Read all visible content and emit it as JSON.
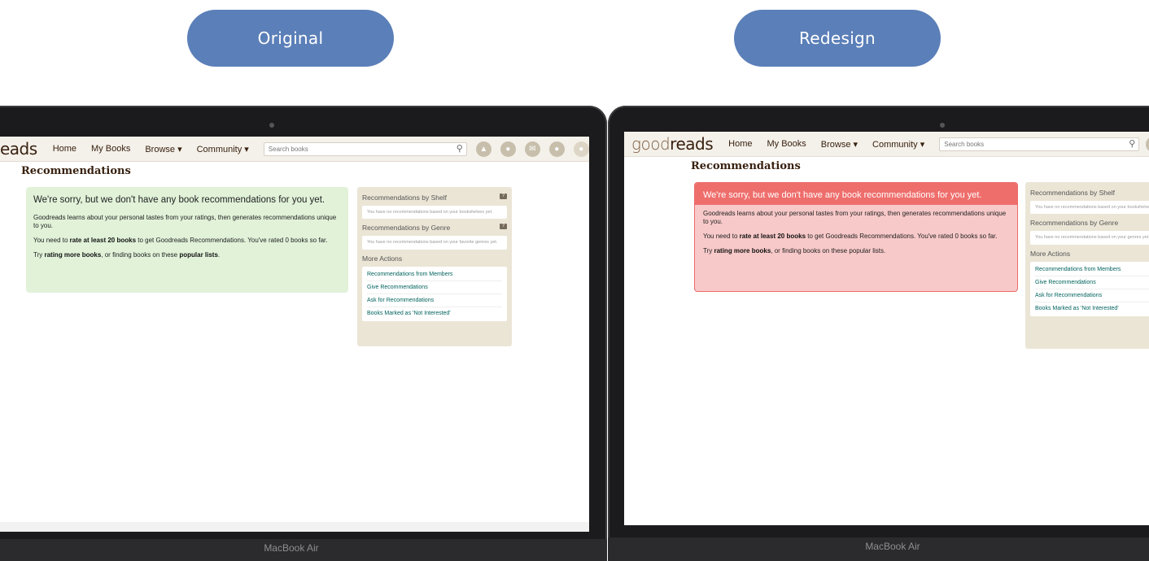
{
  "labels": {
    "original": "Original",
    "redesign": "Redesign"
  },
  "chin_label": "MacBook Air",
  "original": {
    "logo_dark": "eads",
    "logo_light": "",
    "nav": [
      "Home",
      "My Books",
      "Browse ▾",
      "Community ▾"
    ],
    "search_placeholder": "Search books",
    "page_title": "Recommendations",
    "sorry_title": "We're sorry, but we don't have any book recommendations for you yet.",
    "p1": "Goodreads learns about your personal tastes from your ratings, then generates recommendations unique to you.",
    "p2_pre": "You need to ",
    "p2_bold": "rate at least 20 books",
    "p2_post": " to get Goodreads Recommendations. You've rated 0 books so far.",
    "p3_pre": "Try ",
    "p3_bold1": "rating more books",
    "p3_mid": ", or finding books on these ",
    "p3_bold2": "popular lists",
    "p3_end": ".",
    "side_shelf_title": "Recommendations by Shelf",
    "side_shelf_text": "You have no recommendations based on your bookshelves yet.",
    "side_genre_title": "Recommendations by Genre",
    "side_genre_text": "You have no recommendations based on your favorite genres yet.",
    "side_more_title": "More Actions",
    "links": [
      "Recommendations from Members",
      "Give Recommendations",
      "Ask for Recommendations",
      "Books Marked as 'Not Interested'"
    ],
    "help_mark": "?"
  },
  "redesign": {
    "logo_light": "good",
    "logo_dark": "reads",
    "nav": [
      "Home",
      "My Books",
      "Browse ▾",
      "Community ▾"
    ],
    "search_placeholder": "Search books",
    "page_title": "Recommendations",
    "sorry_title": "We're sorry, but we don't have any book recommendations for you yet.",
    "p1": "Goodreads learns about your personal tastes from your ratings, then generates recommendations unique to you.",
    "p2_pre": "You need to ",
    "p2_bold": "rate at least 20 books",
    "p2_post": " to get Goodreads Recommendations. You've rated 0 books so far.",
    "p3_pre": "Try ",
    "p3_bold1": "rating more books",
    "p3_mid": ", or finding books on these popular lists.",
    "side_shelf_title": "Recommendations by Shelf",
    "side_shelf_text": "You have no recommendations based on your bookshelves yet.",
    "side_genre_title": "Recommendations by Genre",
    "side_genre_text": "You have no recommendations based on your genres yet.",
    "side_more_title": "More Actions",
    "links": [
      "Recommendations from Members",
      "Give Recommendations",
      "Ask for Recommendations",
      "Books Marked as 'Not Interested'"
    ]
  },
  "colors": {
    "pill": "#5b7fb8",
    "original_message_bg": "#e1f2d9",
    "redesign_message_bg": "#f8c9c9",
    "redesign_message_header": "#ee6e6c",
    "sidebar_bg": "#ebe5d6",
    "link": "#00635d"
  }
}
